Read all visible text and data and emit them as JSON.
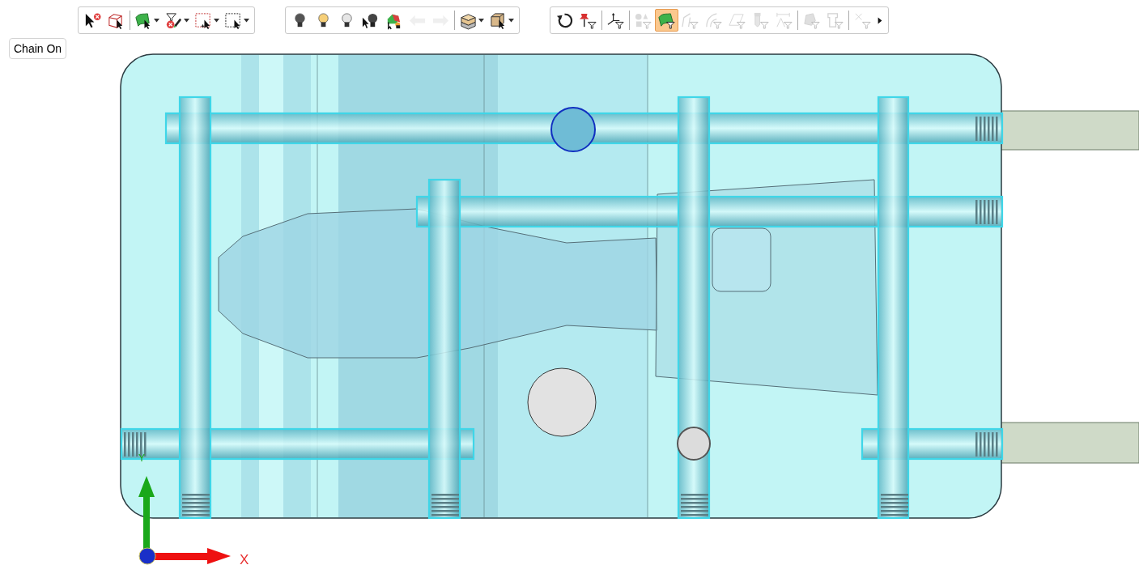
{
  "toolbars": [
    {
      "tools": [
        {
          "kind": "pointer-cancel",
          "dropdown": false,
          "disabled": false,
          "selected": false
        },
        {
          "kind": "cube-pointer",
          "dropdown": false,
          "disabled": false,
          "selected": false
        },
        {
          "kind": "separator"
        },
        {
          "kind": "surface-pointer",
          "dropdown": true,
          "disabled": false,
          "selected": false
        },
        {
          "kind": "filter-pen",
          "dropdown": true,
          "disabled": false,
          "selected": false
        },
        {
          "kind": "window-plus",
          "dropdown": true,
          "disabled": false,
          "selected": false
        },
        {
          "kind": "window",
          "dropdown": true,
          "disabled": false,
          "selected": false
        }
      ]
    },
    {
      "tools": [
        {
          "kind": "bulb-dark",
          "dropdown": false,
          "disabled": false,
          "selected": false
        },
        {
          "kind": "bulb-lit",
          "dropdown": false,
          "disabled": false,
          "selected": false
        },
        {
          "kind": "bulb-pale",
          "dropdown": false,
          "disabled": false,
          "selected": false
        },
        {
          "kind": "pointer-bulb",
          "dropdown": false,
          "disabled": false,
          "selected": false
        },
        {
          "kind": "shading",
          "dropdown": false,
          "disabled": false,
          "selected": false
        },
        {
          "kind": "arrow-left",
          "dropdown": false,
          "disabled": true,
          "selected": false
        },
        {
          "kind": "arrow-right",
          "dropdown": false,
          "disabled": true,
          "selected": false
        },
        {
          "kind": "separator"
        },
        {
          "kind": "box",
          "dropdown": true,
          "disabled": false,
          "selected": false
        },
        {
          "kind": "box-pointer",
          "dropdown": true,
          "disabled": false,
          "selected": false
        }
      ]
    },
    {
      "tools": [
        {
          "kind": "rotate",
          "dropdown": false,
          "disabled": false,
          "selected": false
        },
        {
          "kind": "pin-filter",
          "dropdown": false,
          "disabled": false,
          "selected": false
        },
        {
          "kind": "separator"
        },
        {
          "kind": "axes-filter",
          "dropdown": false,
          "disabled": false,
          "selected": false
        },
        {
          "kind": "separator"
        },
        {
          "kind": "solids-filter",
          "dropdown": false,
          "disabled": true,
          "selected": false
        },
        {
          "kind": "surface-filter",
          "dropdown": false,
          "disabled": false,
          "selected": true
        },
        {
          "kind": "curve-filter",
          "dropdown": false,
          "disabled": true,
          "selected": false
        },
        {
          "kind": "arc-filter",
          "dropdown": false,
          "disabled": true,
          "selected": false
        },
        {
          "kind": "plane-filter",
          "dropdown": false,
          "disabled": true,
          "selected": false
        },
        {
          "kind": "tool-filter",
          "dropdown": false,
          "disabled": true,
          "selected": false
        },
        {
          "kind": "dimension-filter",
          "dropdown": false,
          "disabled": true,
          "selected": false
        },
        {
          "kind": "separator"
        },
        {
          "kind": "shape-filter",
          "dropdown": false,
          "disabled": true,
          "selected": false
        },
        {
          "kind": "section-filter",
          "dropdown": false,
          "disabled": true,
          "selected": false
        },
        {
          "kind": "separator"
        },
        {
          "kind": "point-filter",
          "dropdown": false,
          "disabled": true,
          "selected": false
        },
        {
          "kind": "overflow",
          "dropdown": false,
          "disabled": false,
          "selected": false
        }
      ]
    }
  ],
  "chain_button": {
    "label": "Chain On"
  },
  "axes": {
    "x_label": "X",
    "y_label": "Y"
  }
}
